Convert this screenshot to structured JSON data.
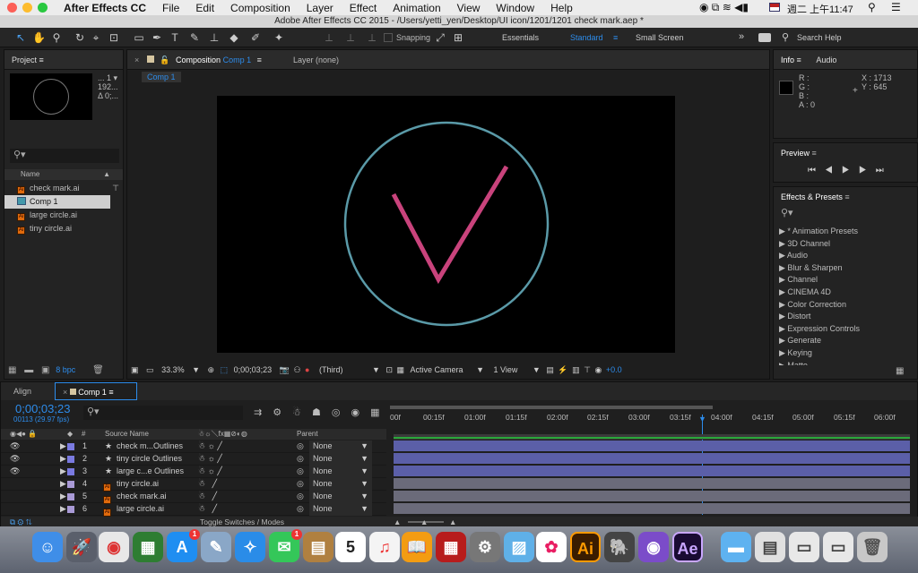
{
  "menubar": {
    "app": "After Effects CC",
    "items": [
      "File",
      "Edit",
      "Composition",
      "Layer",
      "Effect",
      "Animation",
      "View",
      "Window",
      "Help"
    ],
    "clock": "週二 上午11:47"
  },
  "titlebar": {
    "text": "Adobe After Effects CC 2015 - /Users/yetti_yen/Desktop/UI icon/1201/1201 check mark.aep *"
  },
  "toolbar": {
    "snapping": "Snapping",
    "workspaces": [
      "Essentials",
      "Standard",
      "Small Screen"
    ],
    "search": "Search Help"
  },
  "project": {
    "title": "Project",
    "info": [
      "... 1 ▾",
      "192...",
      "Δ 0;..."
    ],
    "col_name": "Name",
    "items": [
      "check mark.ai",
      "Comp 1",
      "large circle.ai",
      "tiny circle.ai"
    ],
    "bpc": "8 bpc"
  },
  "comp": {
    "tab": "Composition",
    "tab_name": "Comp 1",
    "layer_tab": "Layer (none)",
    "crumb": "Comp 1",
    "zoom": "33.3%",
    "time": "0;00;03;23",
    "resolution": "(Third)",
    "camera": "Active Camera",
    "views": "1 View",
    "offset": "+0.0"
  },
  "info": {
    "title": "Info",
    "audio": "Audio",
    "r": "R :",
    "g": "G :",
    "b": "B :",
    "a": "A : 0",
    "x": "X : 1713",
    "y": "Y : 645"
  },
  "preview": {
    "title": "Preview"
  },
  "effects": {
    "title": "Effects & Presets",
    "items": [
      "▶ * Animation Presets",
      "▶ 3D Channel",
      "▶ Audio",
      "▶ Blur & Sharpen",
      "▶ Channel",
      "▶ CINEMA 4D",
      "▶ Color Correction",
      "▶ Distort",
      "▶ Expression Controls",
      "▶ Generate",
      "▶ Keying",
      "▶ Matte"
    ]
  },
  "timeline": {
    "align_tab": "Align",
    "comp_tab": "Comp 1",
    "timecode": "0;00;03;23",
    "frames": "00113 (29.97 fps)",
    "col_source": "Source Name",
    "col_parent": "Parent",
    "toggle": "Toggle Switches / Modes",
    "ruler": [
      "00f",
      "00:15f",
      "01:00f",
      "01:15f",
      "02:00f",
      "02:15f",
      "03:00f",
      "03:15f",
      "04:00f",
      "04:15f",
      "05:00f",
      "05:15f",
      "06:00f"
    ],
    "layers": [
      {
        "num": "1",
        "name": "check m...Outlines",
        "parent": "None",
        "color": "#7a7ae0",
        "type": "star"
      },
      {
        "num": "2",
        "name": "tiny circle Outlines",
        "parent": "None",
        "color": "#7a7ae0",
        "type": "star"
      },
      {
        "num": "3",
        "name": "large c...e Outlines",
        "parent": "None",
        "color": "#7a7ae0",
        "type": "star"
      },
      {
        "num": "4",
        "name": "tiny circle.ai",
        "parent": "None",
        "color": "#a99ad6",
        "type": "ai"
      },
      {
        "num": "5",
        "name": "check mark.ai",
        "parent": "None",
        "color": "#a99ad6",
        "type": "ai"
      },
      {
        "num": "6",
        "name": "large circle.ai",
        "parent": "None",
        "color": "#a99ad6",
        "type": "ai"
      }
    ]
  },
  "dock": {
    "badge1": "1",
    "badge2": "1",
    "calendar_day": "5"
  }
}
